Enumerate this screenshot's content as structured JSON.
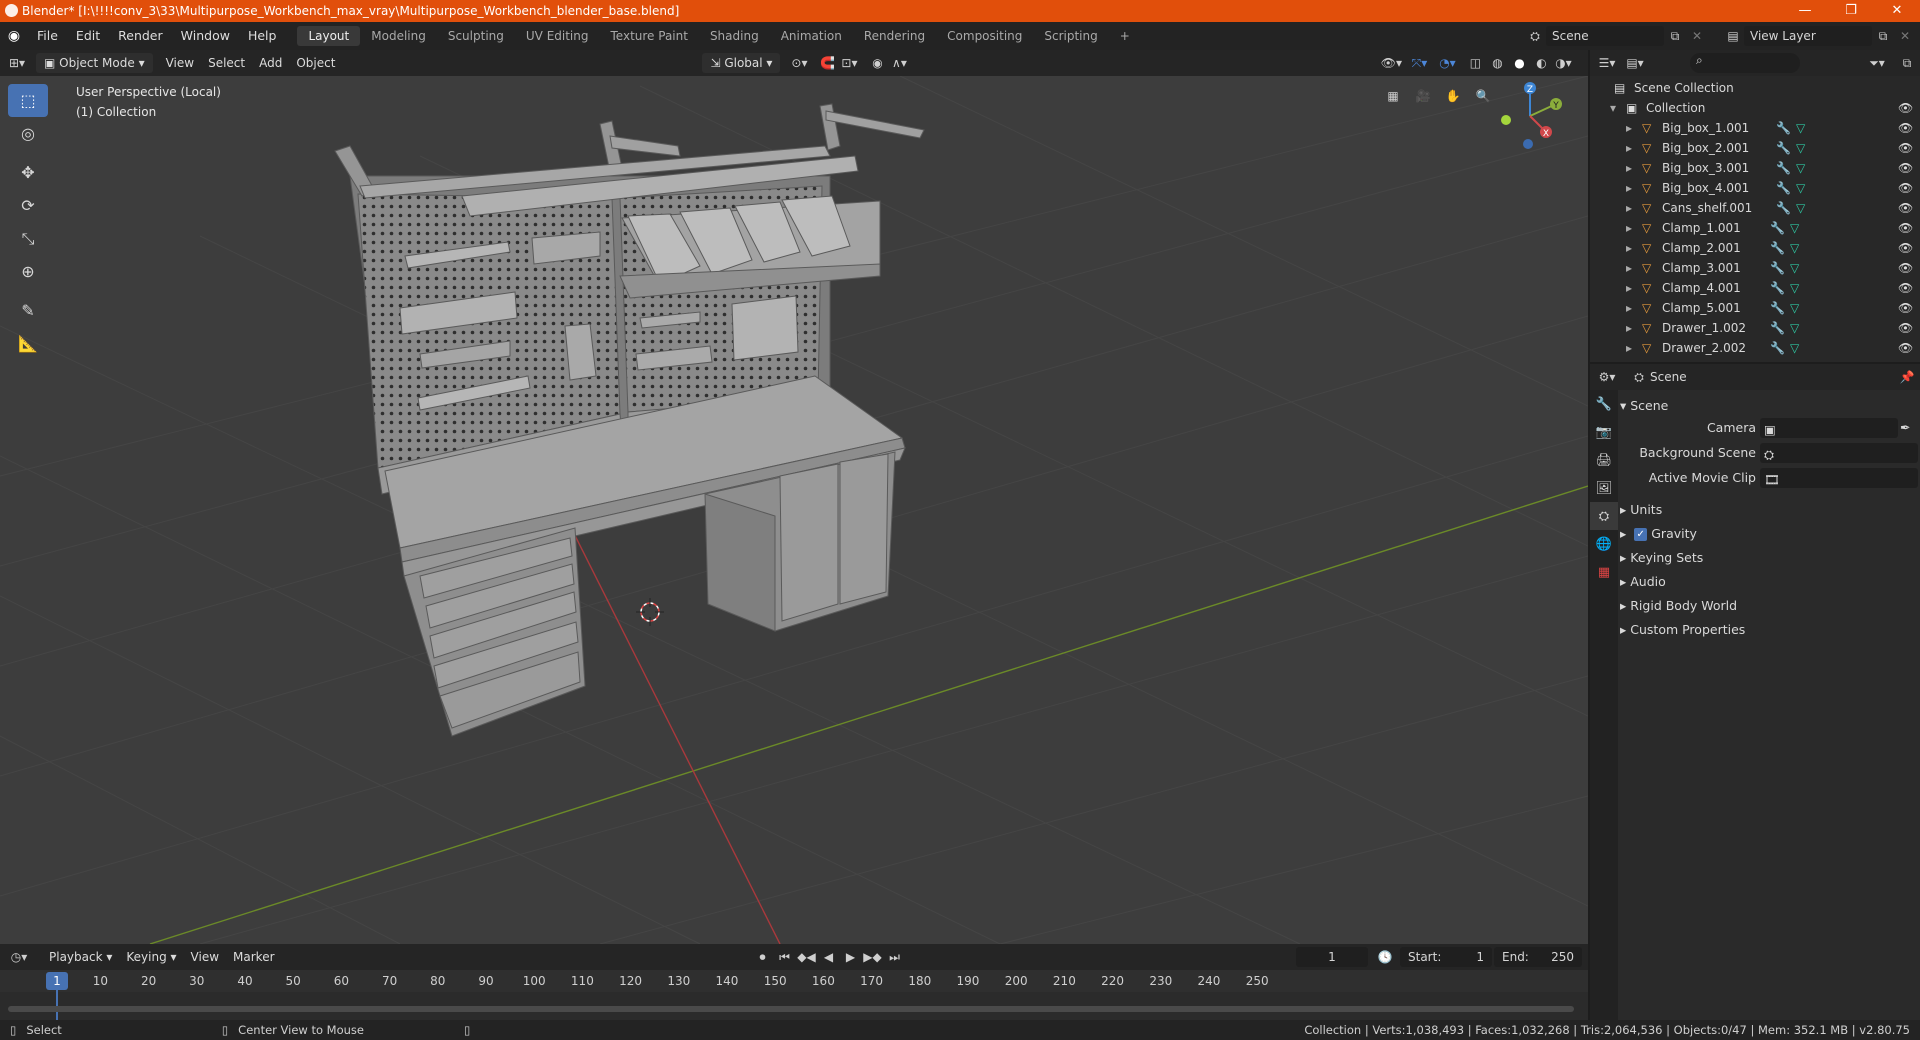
{
  "window": {
    "title": "Blender* [I:\\!!!!conv_3\\33\\Multipurpose_Workbench_max_vray\\Multipurpose_Workbench_blender_base.blend]",
    "minimize": "—",
    "maximize": "❐",
    "close": "✕"
  },
  "menu": {
    "items": [
      "File",
      "Edit",
      "Render",
      "Window",
      "Help"
    ]
  },
  "workspaces": [
    "Layout",
    "Modeling",
    "Sculpting",
    "UV Editing",
    "Texture Paint",
    "Shading",
    "Animation",
    "Rendering",
    "Compositing",
    "Scripting",
    "+"
  ],
  "scene_selector": {
    "value": "Scene"
  },
  "view_layer_selector": {
    "value": "View Layer"
  },
  "viewport_header": {
    "mode": "Object Mode",
    "menus": [
      "View",
      "Select",
      "Add",
      "Object"
    ],
    "orientation": "Global"
  },
  "viewport": {
    "info_line1": "User Perspective (Local)",
    "info_line2": "(1) Collection",
    "gizmo": {
      "x": "X",
      "y": "Y",
      "z": "Z"
    }
  },
  "outliner": {
    "search_placeholder": "",
    "root": "Scene Collection",
    "collection": "Collection",
    "objects": [
      "Big_box_1.001",
      "Big_box_2.001",
      "Big_box_3.001",
      "Big_box_4.001",
      "Cans_shelf.001",
      "Clamp_1.001",
      "Clamp_2.001",
      "Clamp_3.001",
      "Clamp_4.001",
      "Clamp_5.001",
      "Drawer_1.002",
      "Drawer_2.002"
    ]
  },
  "properties": {
    "header": "Scene",
    "section": "Scene",
    "fields": [
      {
        "label": "Camera",
        "value": ""
      },
      {
        "label": "Background Scene",
        "value": ""
      },
      {
        "label": "Active Movie Clip",
        "value": ""
      }
    ],
    "panels": [
      "Units",
      "Gravity",
      "Keying Sets",
      "Audio",
      "Rigid Body World",
      "Custom Properties"
    ],
    "gravity_checked": true
  },
  "timeline": {
    "menus": [
      "Playback",
      "Keying",
      "View",
      "Marker"
    ],
    "current_frame": "1",
    "start_label": "Start:",
    "start": "1",
    "end_label": "End:",
    "end": "250",
    "ruler": [
      "1",
      "10",
      "20",
      "30",
      "40",
      "50",
      "60",
      "70",
      "80",
      "90",
      "100",
      "110",
      "120",
      "130",
      "140",
      "150",
      "160",
      "170",
      "180",
      "190",
      "200",
      "210",
      "220",
      "230",
      "240",
      "250"
    ]
  },
  "statusbar": {
    "left1": "Select",
    "left2": "Center View to Mouse",
    "right": "Collection | Verts:1,038,493 | Faces:1,032,268 | Tris:2,064,536 | Objects:0/47 | Mem: 352.1 MB | v2.80.75"
  },
  "colors": {
    "titlebar": "#e14f0b",
    "accent": "#4772b3",
    "x_axis": "#d1484b",
    "y_axis": "#8bad3b",
    "z_axis": "#3d86d5"
  }
}
